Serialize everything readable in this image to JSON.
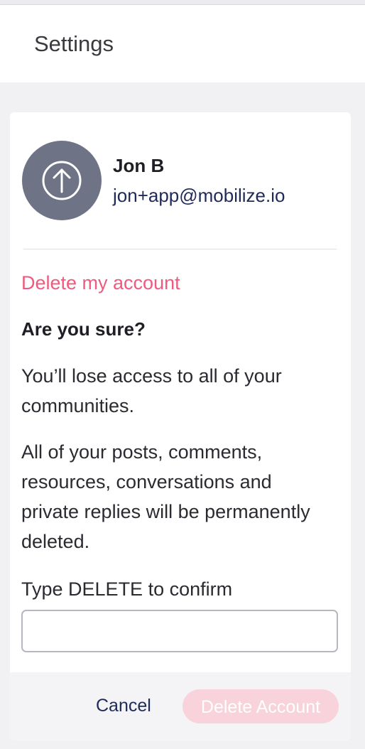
{
  "header": {
    "title": "Settings"
  },
  "profile": {
    "avatar_icon": "upload-arrow-icon",
    "name": "Jon B",
    "email": "jon+app@mobilize.io"
  },
  "delete_section": {
    "link_label": "Delete my account",
    "heading": "Are you sure?",
    "paragraph1": "You’ll lose access to all of your communities.",
    "paragraph2": "All of your posts, comments, resources, conversations and private replies will be permanently deleted.",
    "confirm_label": "Type DELETE to confirm",
    "confirm_value": "",
    "confirm_placeholder": ""
  },
  "footer": {
    "cancel_label": "Cancel",
    "delete_label": "Delete Account"
  },
  "colors": {
    "accent_pink": "#ef5b7e",
    "disabled_button": "#f9d3dc",
    "link_navy": "#1f2a5a",
    "avatar_gray": "#6e7486"
  }
}
